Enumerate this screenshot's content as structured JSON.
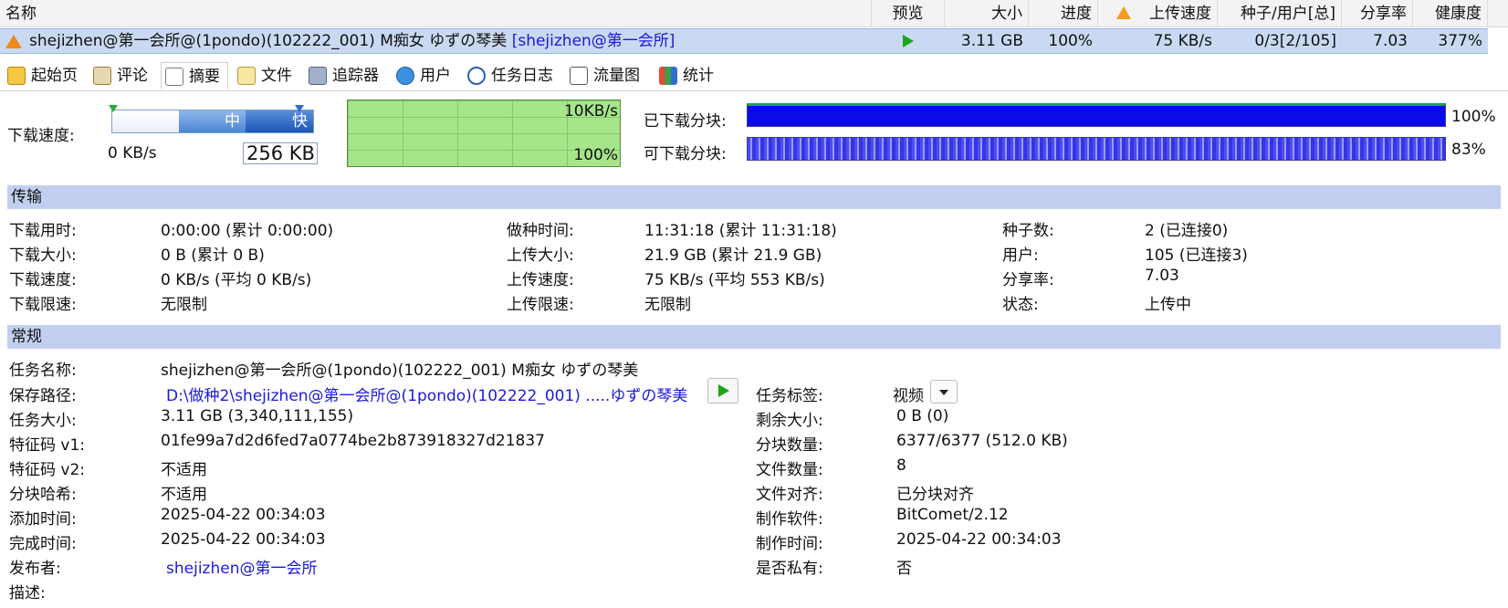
{
  "list": {
    "columns": [
      "名称",
      "预览",
      "大小",
      "进度",
      "上传速度",
      "种子/用户[总]",
      "分享率",
      "健康度"
    ],
    "row": {
      "name": "shejizhen@第一会所@(1pondo)(102222_001) M痴女 ゆずの琴美",
      "tag": "[shejizhen@第一会所]",
      "size": "3.11 GB",
      "progress": "100%",
      "upload_speed": "75 KB/s",
      "peers": "0/3[2/105]",
      "ratio": "7.03",
      "health": "377%"
    }
  },
  "tabs": [
    "起始页",
    "评论",
    "摘要",
    "文件",
    "追踪器",
    "用户",
    "任务日志",
    "流量图",
    "统计"
  ],
  "speed": {
    "label": "下载速度:",
    "mid": "中",
    "fast": "快",
    "current": "0 KB/s",
    "limit": "256 KB",
    "graph_top": "10KB/s",
    "graph_bottom": "100%"
  },
  "pieces": {
    "downloaded_label": "已下载分块:",
    "downloaded_pct": "100%",
    "available_label": "可下载分块:",
    "available_pct": "83%"
  },
  "transfer": {
    "title": "传输",
    "rows": [
      [
        "下载用时:",
        "0:00:00 (累计 0:00:00)",
        "做种时间:",
        "11:31:18 (累计 11:31:18)",
        "种子数:",
        "2 (已连接0)"
      ],
      [
        "下载大小:",
        "0 B (累计 0 B)",
        "上传大小:",
        "21.9 GB (累计 21.9 GB)",
        "用户:",
        "105 (已连接3)"
      ],
      [
        "下载速度:",
        "0 KB/s (平均 0 KB/s)",
        "上传速度:",
        "75 KB/s (平均 553 KB/s)",
        "分享率:",
        "7.03"
      ],
      [
        "下载限速:",
        "无限制",
        "上传限速:",
        "无限制",
        "状态:",
        "上传中"
      ]
    ]
  },
  "general": {
    "title": "常规",
    "task_name_label": "任务名称:",
    "task_name": "shejizhen@第一会所@(1pondo)(102222_001) M痴女 ゆずの琴美",
    "save_path_label": "保存路径:",
    "save_path": "D:\\做种2\\shejizhen@第一会所@(1pondo)(102222_001) .....ゆずの琴美",
    "task_tag_label": "任务标签:",
    "task_tag": "视频",
    "rows": [
      [
        "任务大小:",
        "3.11 GB (3,340,111,155)",
        "剩余大小:",
        "0 B (0)"
      ],
      [
        "特征码 v1:",
        "01fe99a7d2d6fed7a0774be2b873918327d21837",
        "分块数量:",
        "6377/6377 (512.0 KB)"
      ],
      [
        "特征码 v2:",
        "不适用",
        "文件数量:",
        "8"
      ],
      [
        "分块哈希:",
        "不适用",
        "文件对齐:",
        "已分块对齐"
      ],
      [
        "添加时间:",
        "2025-04-22 00:34:03",
        "制作软件:",
        "BitComet/2.12"
      ],
      [
        "完成时间:",
        "2025-04-22 00:34:03",
        "制作时间:",
        "2025-04-22 00:34:03"
      ]
    ],
    "publisher_label": "发布者:",
    "publisher": "shejizhen@第一会所",
    "private_label": "是否私有:",
    "private": "否",
    "desc_label": "描述:"
  }
}
